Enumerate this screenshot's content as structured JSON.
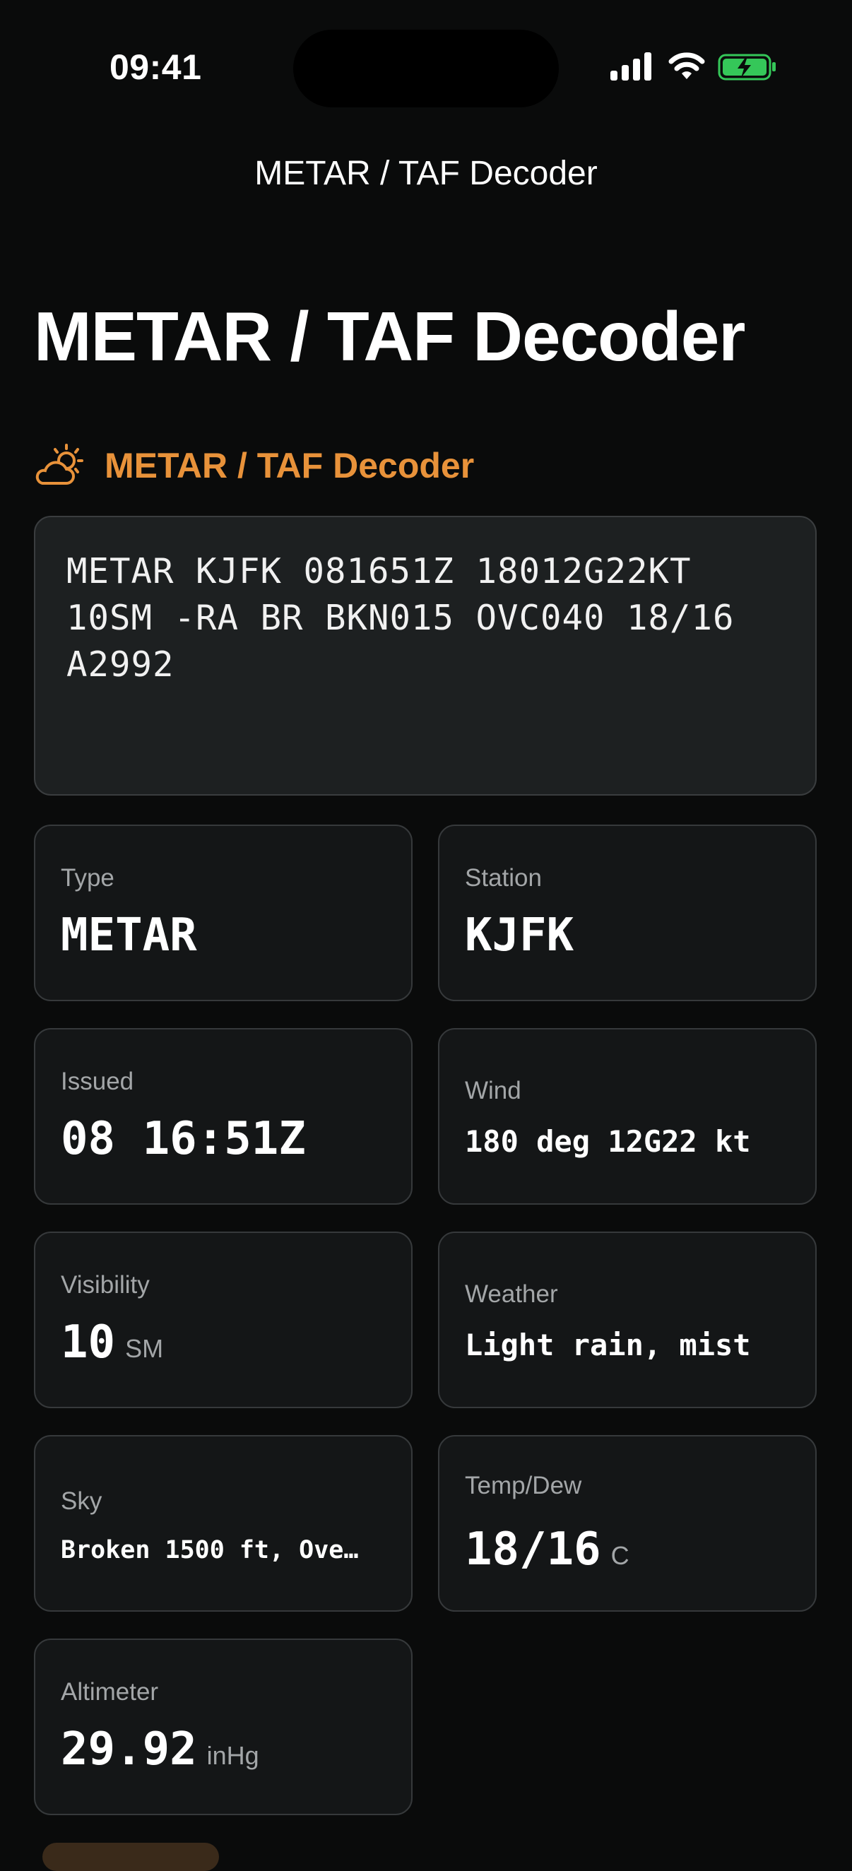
{
  "status_bar": {
    "time": "09:41"
  },
  "nav": {
    "title": "METAR / TAF Decoder"
  },
  "page": {
    "title": "METAR / TAF Decoder"
  },
  "section": {
    "label": "METAR / TAF Decoder",
    "icon": "partly-cloudy-sun-icon",
    "accent": "#e8923a"
  },
  "raw_report": "METAR KJFK 081651Z 18012G22KT 10SM -RA BR BKN015 OVC040 18/16 A2992",
  "fields": {
    "type": {
      "label": "Type",
      "value": "METAR"
    },
    "station": {
      "label": "Station",
      "value": "KJFK"
    },
    "issued": {
      "label": "Issued",
      "value": "08 16:51Z"
    },
    "wind": {
      "label": "Wind",
      "value": "180 deg 12G22 kt"
    },
    "visibility": {
      "label": "Visibility",
      "value": "10",
      "unit": "SM"
    },
    "weather": {
      "label": "Weather",
      "value": "Light rain, mist"
    },
    "sky": {
      "label": "Sky",
      "value": "Broken 1500 ft, Ove…"
    },
    "temp_dew": {
      "label": "Temp/Dew",
      "value": "18/16",
      "unit": "C"
    },
    "altimeter": {
      "label": "Altimeter",
      "value": "29.92",
      "unit": "inHg"
    }
  }
}
